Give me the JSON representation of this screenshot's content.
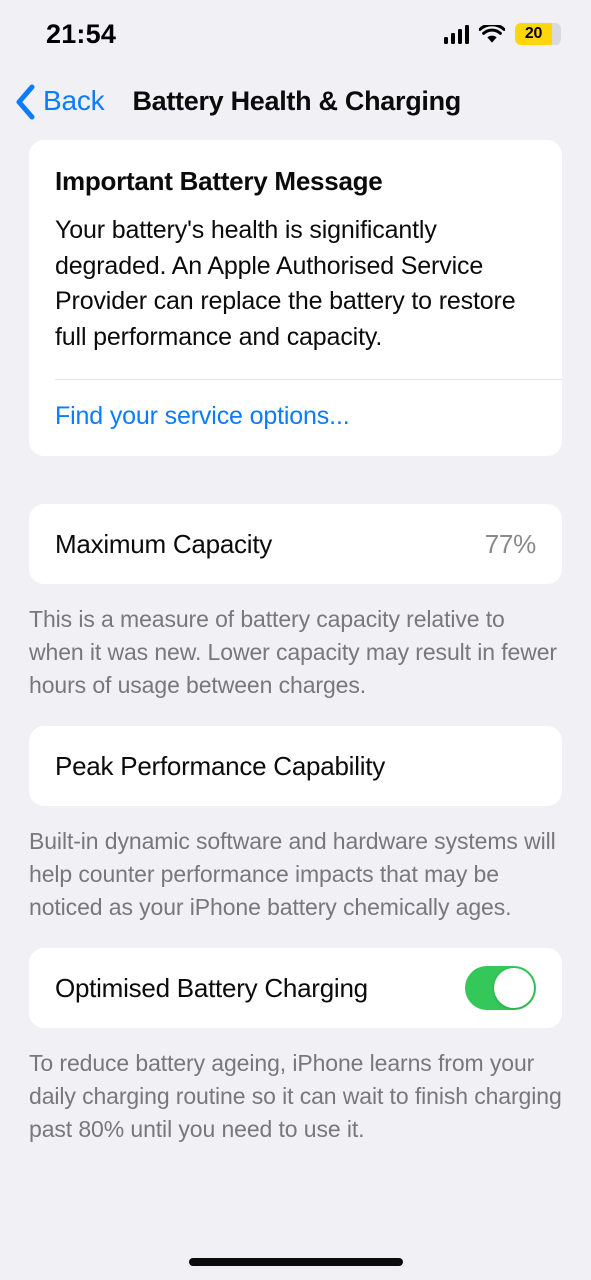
{
  "status_bar": {
    "time": "21:54",
    "signal_icon": "cellular-signal-icon",
    "wifi_icon": "wifi-icon",
    "battery_level": "20",
    "battery_color": "#ffd60a"
  },
  "nav": {
    "back_label": "Back",
    "back_icon": "chevron-left-icon",
    "title": "Battery Health & Charging"
  },
  "message_card": {
    "title": "Important Battery Message",
    "body": "Your battery's health is significantly degraded. An Apple Authorised Service Provider can replace the battery to restore full performance and capacity.",
    "link_label": "Find your service options...",
    "link_color": "#0a7cff"
  },
  "maximum_capacity": {
    "label": "Maximum Capacity",
    "value": "77%",
    "footer": "This is a measure of battery capacity relative to when it was new. Lower capacity may result in fewer hours of usage between charges."
  },
  "peak_performance": {
    "label": "Peak Performance Capability",
    "footer": "Built-in dynamic software and hardware systems will help counter performance impacts that may be noticed as your iPhone battery chemically ages."
  },
  "optimised_charging": {
    "label": "Optimised Battery Charging",
    "toggle_state": "on",
    "toggle_color": "#34c759",
    "footer": "To reduce battery ageing, iPhone learns from your daily charging routine so it can wait to finish charging past 80% until you need to use it."
  }
}
